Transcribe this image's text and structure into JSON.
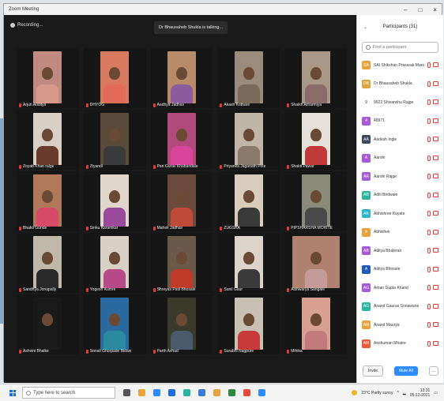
{
  "window": {
    "title": "Zoom Meeting",
    "controls": [
      "–",
      "□",
      "×"
    ]
  },
  "meeting": {
    "recording_label": "Recording...",
    "speaking_label": "Dr Bhausaheb Shukla is talking...",
    "tiles": [
      {
        "name": "Arjun Auditya",
        "bg": "#c08a80",
        "torso": "#d79a8a",
        "wide": false
      },
      {
        "name": "DHYOG",
        "bg": "#d87a60",
        "torso": "#e36b5a",
        "wide": false
      },
      {
        "name": "Aadhya Jadhav",
        "bg": "#b88c6a",
        "torso": "#8c5c9c",
        "wide": false
      },
      {
        "name": "Akash Kothare",
        "bg": "#9a8c7c",
        "torso": "#7a6a5a",
        "wide": false
      },
      {
        "name": "Shaikh Atharmiya",
        "bg": "#a89888",
        "torso": "#8a6a6a",
        "wide": false
      },
      {
        "name": "Zoyab Khan ralge",
        "bg": "#d8cfc6",
        "torso": "#6a3a2a",
        "wide": false
      },
      {
        "name": "Ziyandi",
        "bg": "#5a4a3a",
        "torso": "#3a3a3a",
        "wide": false
      },
      {
        "name": "Pari Gurav Khabandale",
        "bg": "#b04a7a",
        "torso": "#d8459a",
        "wide": false
      },
      {
        "name": "Priyanka Jaganath Pote",
        "bg": "#bfb6a8",
        "torso": "#8a7a6a",
        "wide": false
      },
      {
        "name": "Shakti Pawar",
        "bg": "#e6e0da",
        "torso": "#c03a3a",
        "wide": false
      },
      {
        "name": "Bhakti Gunde",
        "bg": "#b07a5a",
        "torso": "#d84a6a",
        "wide": false
      },
      {
        "name": "Sinku Karamkar",
        "bg": "#e0d6cc",
        "torso": "#9a4a9a",
        "wide": false
      },
      {
        "name": "Mahek Jadhav",
        "bg": "#6a4a3a",
        "torso": "#c04a3a",
        "wide": false
      },
      {
        "name": "ZUGSKA",
        "bg": "#d8cdbc",
        "torso": "#3a3a3a",
        "wide": false
      },
      {
        "name": "PIPSHARSHA MOHITE",
        "bg": "#8a8a7a",
        "torso": "#4a4a4a",
        "wide": false
      },
      {
        "name": "Sandhya Jonapally",
        "bg": "#c0b8aa",
        "torso": "#2a2a2a",
        "wide": false
      },
      {
        "name": "Yogesh Kumre",
        "bg": "#d8d0c4",
        "torso": "#b84a8a",
        "wide": false
      },
      {
        "name": "Shreyas Patil Bhosale",
        "bg": "#6a5a4a",
        "torso": "#c03a2a",
        "wide": false
      },
      {
        "name": "Sunil Gaur",
        "bg": "#dcd4ca",
        "torso": "#3a3a3a",
        "wide": false
      },
      {
        "name": "Aishwarya Sangale",
        "bg": "#b08070",
        "torso": "#c49a9a",
        "wide": true
      },
      {
        "name": "Ashvini Bhalke",
        "bg": "#1a1a1a",
        "torso": "#1a1a1a",
        "wide": false
      },
      {
        "name": "Sonali Ghorpade Bidwe",
        "bg": "#2a6aa0",
        "torso": "#2a8aa0",
        "wide": false
      },
      {
        "name": "Parth Avhad",
        "bg": "#3a3a2a",
        "torso": "#4a5a6a",
        "wide": false
      },
      {
        "name": "Surabhi Nagpure",
        "bg": "#c8c0b4",
        "torso": "#c83a3a",
        "wide": false
      },
      {
        "name": "Mihika",
        "bg": "#d8a090",
        "torso": "#c07a7a",
        "wide": false
      }
    ]
  },
  "participants": {
    "title": "Participants (31)",
    "search_placeholder": "Find a participant",
    "items": [
      {
        "initials": "SA",
        "name": "SAI Shikshan Prasarak Mandal (Host, me)",
        "color": "#e8a33d"
      },
      {
        "initials": "DB",
        "name": "Dr Bhausaheb Shukla",
        "color": "#d9a441"
      },
      {
        "initials": "9",
        "name": "9922 Shivanshu Rajge",
        "color": "#ffffff"
      },
      {
        "initials": "4",
        "name": "49971",
        "color": "#a65ad6"
      },
      {
        "initials": "AA",
        "name": "Aadesh Ingle",
        "color": "#3a4a5a"
      },
      {
        "initials": "A",
        "name": "Aarohi",
        "color": "#a65ad6"
      },
      {
        "initials": "AR",
        "name": "Aarohi Rajge",
        "color": "#a65ad6"
      },
      {
        "initials": "AB",
        "name": "Aditi Birdwale",
        "color": "#2bb5a0"
      },
      {
        "initials": "AK",
        "name": "Abhishree Kuyate",
        "color": "#2bb5c8"
      },
      {
        "initials": "A",
        "name": "Abhishek",
        "color": "#e8a33d"
      },
      {
        "initials": "AB",
        "name": "Aditya Bhalerao",
        "color": "#a65ad6"
      },
      {
        "initials": "A",
        "name": "Aditya Bhosale",
        "color": "#1e5bb8"
      },
      {
        "initials": "AG",
        "name": "Aman Gupta Khand",
        "color": "#a65ad6"
      },
      {
        "initials": "AG",
        "name": "Anand Gaurav Sonawane",
        "color": "#2bb5a0"
      },
      {
        "initials": "AM",
        "name": "Anand Maurya",
        "color": "#e8a33d"
      },
      {
        "initials": "AM",
        "name": "Anshuman Mhatre",
        "color": "#e85a3a"
      }
    ],
    "invite_label": "Invite",
    "mute_all_label": "Mute All",
    "more_label": "..."
  },
  "taskbar": {
    "search_placeholder": "Type here to search",
    "weather": "23°C Partly sunny",
    "time": "13:31",
    "date": "05-12-2021",
    "app_colors": [
      "#555555",
      "#e8a33d",
      "#2d8cff",
      "#1e6fd9",
      "#2bb5a0",
      "#3a7bd5",
      "#e8a33d",
      "#2a8a3a",
      "#e84a3a",
      "#2d8cff"
    ]
  }
}
